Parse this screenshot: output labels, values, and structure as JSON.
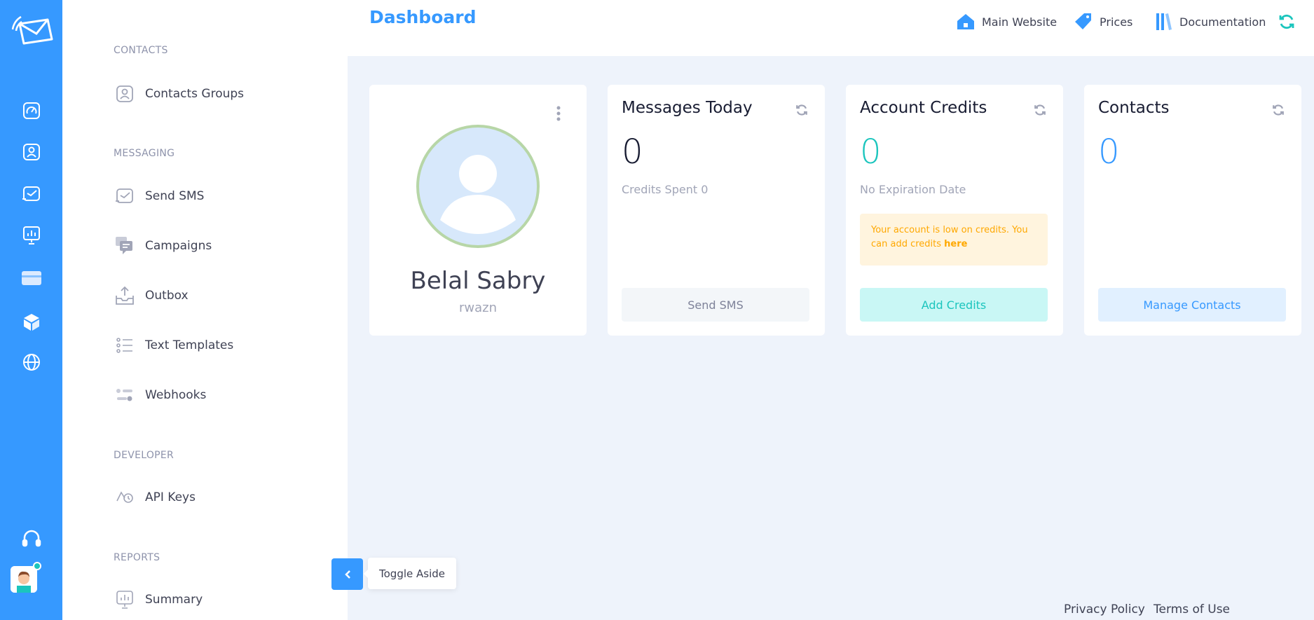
{
  "colors": {
    "primary": "#3699ff",
    "success": "#1bc5bd",
    "warning": "#ffa800",
    "dark": "#181c32"
  },
  "rail": {
    "icons": [
      "mail-logo-icon",
      "dashboard-gauge-icon",
      "contacts-icon",
      "sms-icon",
      "reports-icon",
      "billing-card-icon",
      "box-icon",
      "globe-icon",
      "headset-icon",
      "user-avatar"
    ]
  },
  "aside": {
    "sections": [
      {
        "title": "CONTACTS",
        "items": [
          {
            "label": "Contacts Groups",
            "icon": "contact-card-icon"
          }
        ]
      },
      {
        "title": "MESSAGING",
        "items": [
          {
            "label": "Send SMS",
            "icon": "send-sms-icon"
          },
          {
            "label": "Campaigns",
            "icon": "chat-bubbles-icon"
          },
          {
            "label": "Outbox",
            "icon": "outbox-tray-icon"
          },
          {
            "label": "Text Templates",
            "icon": "list-icon"
          },
          {
            "label": "Webhooks",
            "icon": "webhook-toggle-icon"
          }
        ]
      },
      {
        "title": "DEVELOPER",
        "items": [
          {
            "label": "API Keys",
            "icon": "key-clock-icon"
          }
        ]
      },
      {
        "title": "REPORTS",
        "items": [
          {
            "label": "Summary",
            "icon": "presentation-chart-icon"
          }
        ]
      }
    ],
    "toggle_tooltip": "Toggle Aside"
  },
  "header": {
    "title": "Dashboard",
    "links": [
      {
        "label": "Main Website",
        "icon": "home-icon"
      },
      {
        "label": "Prices",
        "icon": "price-tag-icon"
      },
      {
        "label": "Documentation",
        "icon": "library-icon"
      }
    ]
  },
  "cards": {
    "profile": {
      "name": "Belal Sabry",
      "username": "rwazn"
    },
    "messages": {
      "title": "Messages Today",
      "value": "0",
      "sub": "Credits Spent 0",
      "button": "Send SMS"
    },
    "credits": {
      "title": "Account Credits",
      "value": "0",
      "sub": "No Expiration Date",
      "warning_text": "Your account is low on credits. You can add credits ",
      "warning_link": "here",
      "button": "Add Credits"
    },
    "contacts": {
      "title": "Contacts",
      "value": "0",
      "button": "Manage Contacts"
    }
  },
  "footer": {
    "privacy": "Privacy Policy",
    "terms": "Terms of Use"
  }
}
